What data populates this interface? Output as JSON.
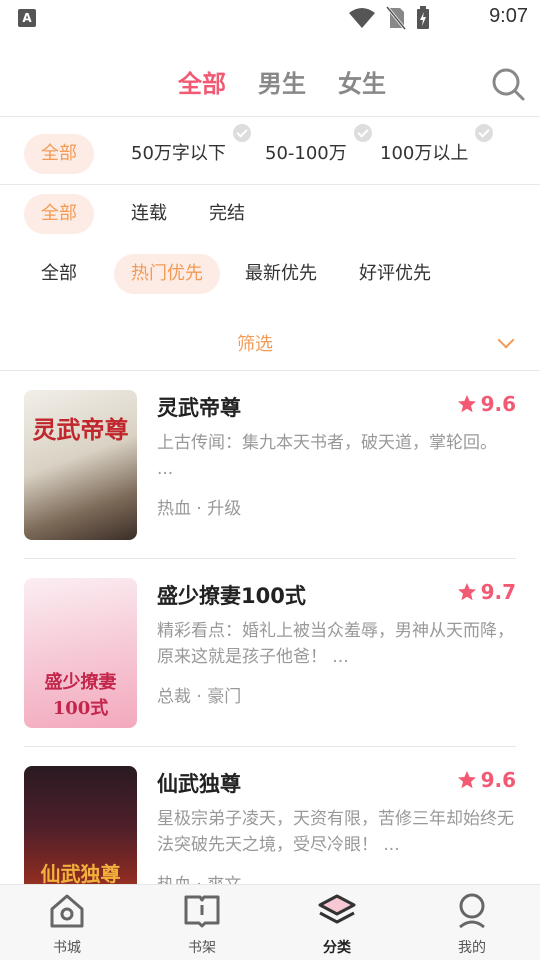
{
  "status_bar": {
    "app_letter": "A",
    "time": "9:07"
  },
  "top_tabs": [
    {
      "label": "全部",
      "active": true
    },
    {
      "label": "男生",
      "active": false
    },
    {
      "label": "女生",
      "active": false
    }
  ],
  "filters": {
    "word_count": [
      "全部",
      "50万字以下",
      "50-100万",
      "100万以上"
    ],
    "status": [
      "全部",
      "连载",
      "完结"
    ],
    "sort": [
      "全部",
      "热门优先",
      "最新优先",
      "好评优先"
    ],
    "toggle_label": "筛选"
  },
  "books": [
    {
      "title": "灵武帝尊",
      "rating": "9.6",
      "description": "上古传闻：集九本天书者，破天道，掌轮回。 ...",
      "tags": "热血 · 升级",
      "cover_text": "灵武帝尊"
    },
    {
      "title": "盛少撩妻100式",
      "rating": "9.7",
      "description": "精彩看点：婚礼上被当众羞辱，男神从天而降，原来这就是孩子他爸！ ...",
      "tags": "总裁 · 豪门",
      "cover_text": "盛少撩妻100式"
    },
    {
      "title": "仙武独尊",
      "rating": "9.6",
      "description": "星极宗弟子凌天，天资有限，苦修三年却始终无法突破先天之境，受尽冷眼！ ...",
      "tags": "热血 · 爽文",
      "cover_text": "仙武独尊"
    }
  ],
  "bottom_nav": [
    {
      "label": "书城",
      "icon": "home-icon"
    },
    {
      "label": "书架",
      "icon": "bookshelf-icon"
    },
    {
      "label": "分类",
      "icon": "layers-icon",
      "active": true
    },
    {
      "label": "我的",
      "icon": "profile-icon"
    }
  ],
  "colors": {
    "accent": "#f25a73",
    "filter_accent": "#f39b56",
    "chip_bg": "#fdece6"
  }
}
